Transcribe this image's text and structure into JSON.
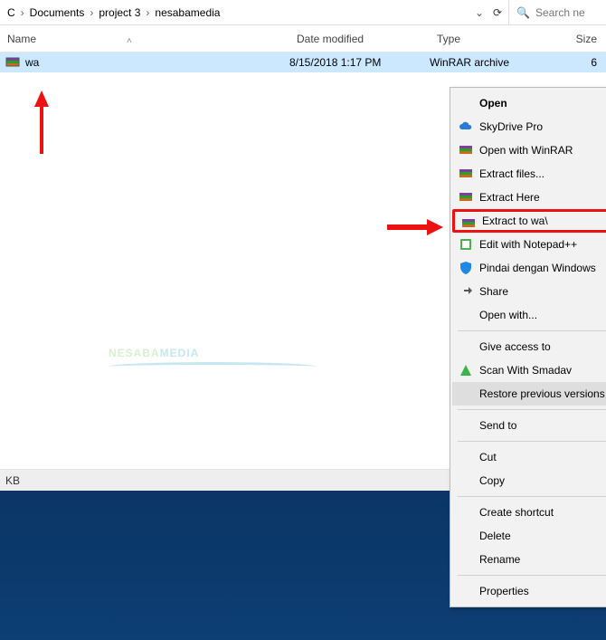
{
  "breadcrumbs": [
    "C",
    "Documents",
    "project 3",
    "nesabamedia"
  ],
  "search": {
    "placeholder": "Search ne"
  },
  "columns": {
    "name": "Name",
    "date": "Date modified",
    "type": "Type",
    "size": "Size"
  },
  "file": {
    "name": "wa",
    "date": "8/15/2018 1:17 PM",
    "type": "WinRAR archive",
    "size": "6"
  },
  "status": {
    "text": "KB"
  },
  "context_menu": {
    "open": "Open",
    "skydrive": "SkyDrive Pro",
    "open_winrar": "Open with WinRAR",
    "extract_files": "Extract files...",
    "extract_here": "Extract Here",
    "extract_to": "Extract to wa\\",
    "edit_notepad": "Edit with Notepad++",
    "pindai": "Pindai dengan Windows",
    "share": "Share",
    "open_with": "Open with...",
    "give_access": "Give access to",
    "scan_smadav": "Scan With Smadav",
    "restore": "Restore previous versions",
    "send_to": "Send to",
    "cut": "Cut",
    "copy": "Copy",
    "create_shortcut": "Create shortcut",
    "delete": "Delete",
    "rename": "Rename",
    "properties": "Properties"
  },
  "watermark": {
    "a": "NESABA",
    "b": "MEDIA"
  }
}
